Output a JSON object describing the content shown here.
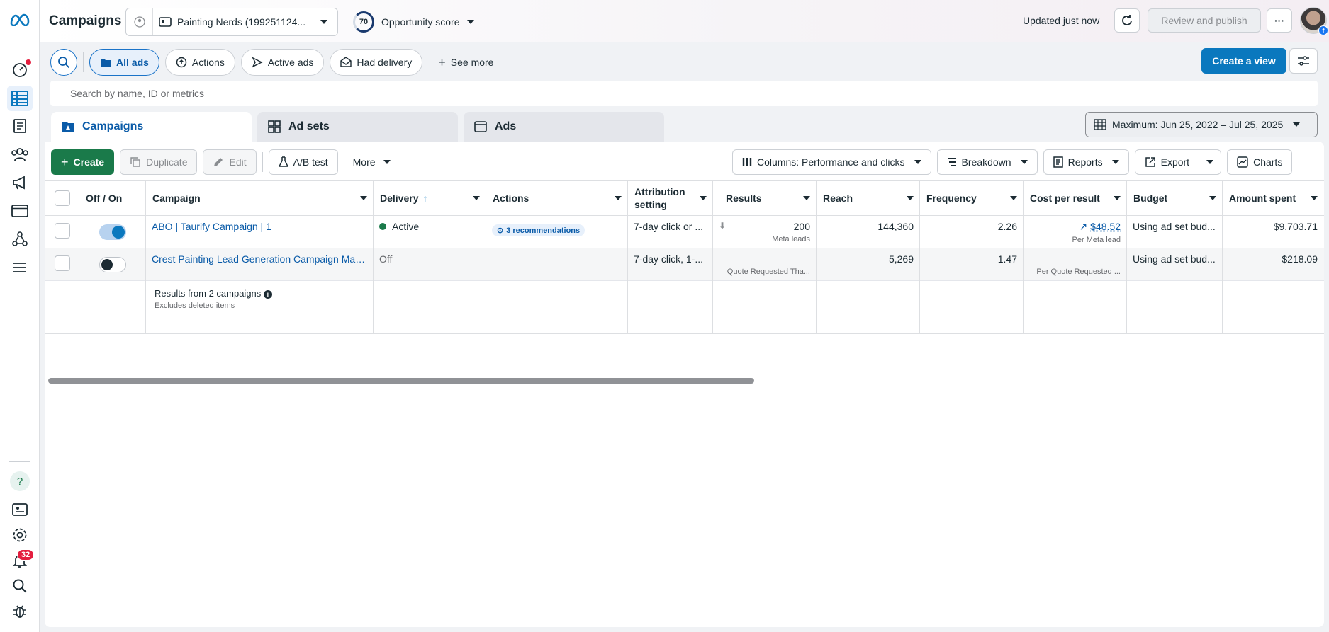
{
  "topbar": {
    "title": "Campaigns",
    "account_name": "Painting Nerds (199251124...",
    "opportunity_score": "70",
    "opportunity_label": "Opportunity score",
    "updated_text": "Updated just now",
    "review_label": "Review and publish",
    "more_label": "···"
  },
  "rail": {
    "notifications_count": "32"
  },
  "filters": {
    "items": [
      "All ads",
      "Actions",
      "Active ads",
      "Had delivery"
    ],
    "see_more": "See more",
    "create_view": "Create a view"
  },
  "search": {
    "placeholder": "Search by name, ID or metrics"
  },
  "tabs": [
    "Campaigns",
    "Ad sets",
    "Ads"
  ],
  "date_range": "Maximum: Jun 25, 2022 – Jul 25, 2025",
  "toolbar": {
    "create": "Create",
    "duplicate": "Duplicate",
    "edit": "Edit",
    "ab_test": "A/B test",
    "more": "More",
    "columns": "Columns: Performance and clicks",
    "breakdown": "Breakdown",
    "reports": "Reports",
    "export": "Export",
    "charts": "Charts"
  },
  "table": {
    "headers": {
      "off_on": "Off / On",
      "campaign": "Campaign",
      "delivery": "Delivery",
      "actions": "Actions",
      "attribution_1": "Attribution",
      "attribution_2": "setting",
      "results": "Results",
      "reach": "Reach",
      "frequency": "Frequency",
      "cost_per_result": "Cost per result",
      "budget": "Budget",
      "amount_spent": "Amount spent"
    },
    "rows": [
      {
        "campaign": "ABO | Taurify Campaign | 1",
        "delivery": "Active",
        "actions": "3 recommendations",
        "attribution": "7-day click or ...",
        "results": "200",
        "results_sub": "Meta leads",
        "reach": "144,360",
        "frequency": "2.26",
        "cost_per_result": "$48.52",
        "cost_sub": "Per Meta lead",
        "budget": "Using ad set bud...",
        "amount_spent": "$9,703.71"
      },
      {
        "campaign": "Crest Painting Lead Generation Campaign Man...",
        "delivery": "Off",
        "actions": "—",
        "attribution": "7-day click, 1-...",
        "results": "—",
        "results_sub": "Quote Requested Tha...",
        "reach": "5,269",
        "frequency": "1.47",
        "cost_per_result": "—",
        "cost_sub": "Per Quote Requested ...",
        "budget": "Using ad set bud...",
        "amount_spent": "$218.09"
      }
    ],
    "totals": {
      "label": "Results from 2 campaigns",
      "sub": "Excludes deleted items"
    }
  },
  "colors": {
    "brand_blue": "#0a78be",
    "create_green": "#1a7a4a",
    "alert_red": "#e41e3f"
  }
}
